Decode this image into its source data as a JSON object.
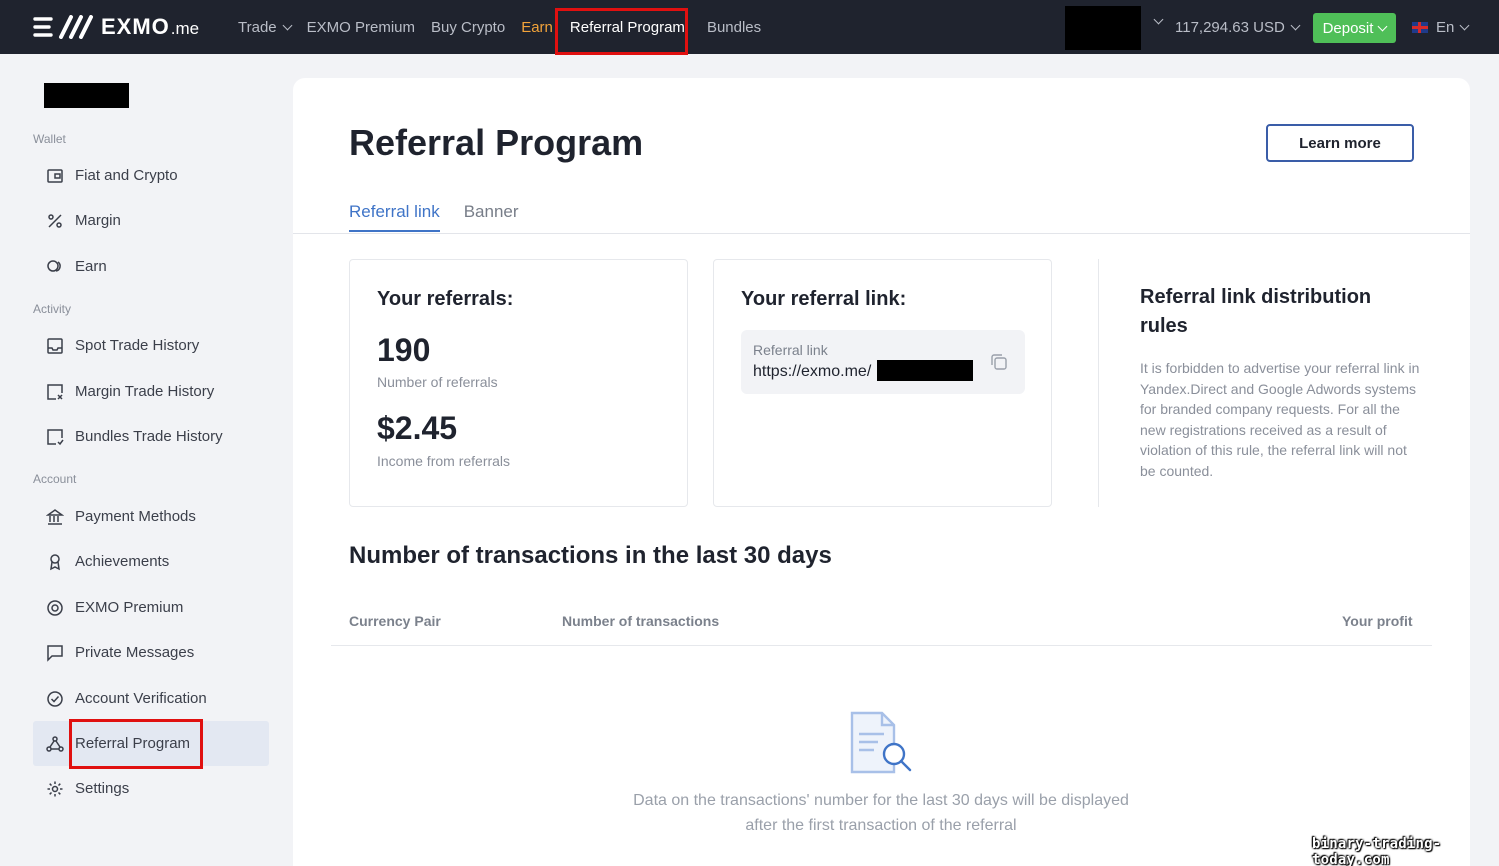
{
  "nav": {
    "logo_text": "EXMO",
    "logo_suffix": ".me",
    "items": [
      {
        "label": "Trade",
        "dropdown": true
      },
      {
        "label": "EXMO Premium"
      },
      {
        "label": "Buy Crypto"
      },
      {
        "label": "Earn"
      },
      {
        "label": "Referral Program"
      },
      {
        "label": "Bundles"
      }
    ],
    "balance": "117,294.63 USD",
    "deposit_label": "Deposit",
    "language": "En",
    "accent_color": "#4fbf58",
    "earn_color": "#f2a33a"
  },
  "sidebar": {
    "sections": [
      {
        "label": "Wallet",
        "items": [
          {
            "label": "Fiat and Crypto",
            "icon": "wallet-icon"
          },
          {
            "label": "Margin",
            "icon": "percent-icon"
          },
          {
            "label": "Earn",
            "icon": "coins-icon"
          }
        ]
      },
      {
        "label": "Activity",
        "items": [
          {
            "label": "Spot Trade History",
            "icon": "inbox-icon"
          },
          {
            "label": "Margin Trade History",
            "icon": "history-x-icon"
          },
          {
            "label": "Bundles Trade History",
            "icon": "history-icon"
          }
        ]
      },
      {
        "label": "Account",
        "items": [
          {
            "label": "Payment Methods",
            "icon": "bank-icon"
          },
          {
            "label": "Achievements",
            "icon": "award-icon"
          },
          {
            "label": "EXMO Premium",
            "icon": "premium-icon"
          },
          {
            "label": "Private Messages",
            "icon": "message-icon"
          },
          {
            "label": "Account Verification",
            "icon": "check-circle-icon"
          },
          {
            "label": "Referral Program",
            "icon": "share-nodes-icon"
          },
          {
            "label": "Settings",
            "icon": "gear-icon"
          }
        ]
      }
    ]
  },
  "main": {
    "title": "Referral Program",
    "learn_more_label": "Learn more",
    "tabs": [
      {
        "label": "Referral link",
        "active": true
      },
      {
        "label": "Banner",
        "active": false
      }
    ],
    "referrals_card": {
      "title": "Your referrals:",
      "count": "190",
      "count_caption": "Number of referrals",
      "income": "$2.45",
      "income_caption": "Income from referrals"
    },
    "link_card": {
      "title": "Your referral link:",
      "field_label": "Referral link",
      "field_value": "https://exmo.me/"
    },
    "rules": {
      "title": "Referral link distribution rules",
      "text": "It is forbidden to advertise your referral link in Yandex.Direct and Google Adwords systems for branded company requests. For all the new registrations received as a result of violation of this rule, the referral link will not be counted."
    },
    "transactions": {
      "title": "Number of transactions in the last 30 days",
      "columns": [
        "Currency Pair",
        "Number of transactions",
        "Your profit"
      ],
      "empty_line1": "Data on the transactions' number for the last 30 days will be displayed",
      "empty_line2": "after the first transaction of the referral"
    }
  },
  "watermark": "binary-trading-today.com"
}
